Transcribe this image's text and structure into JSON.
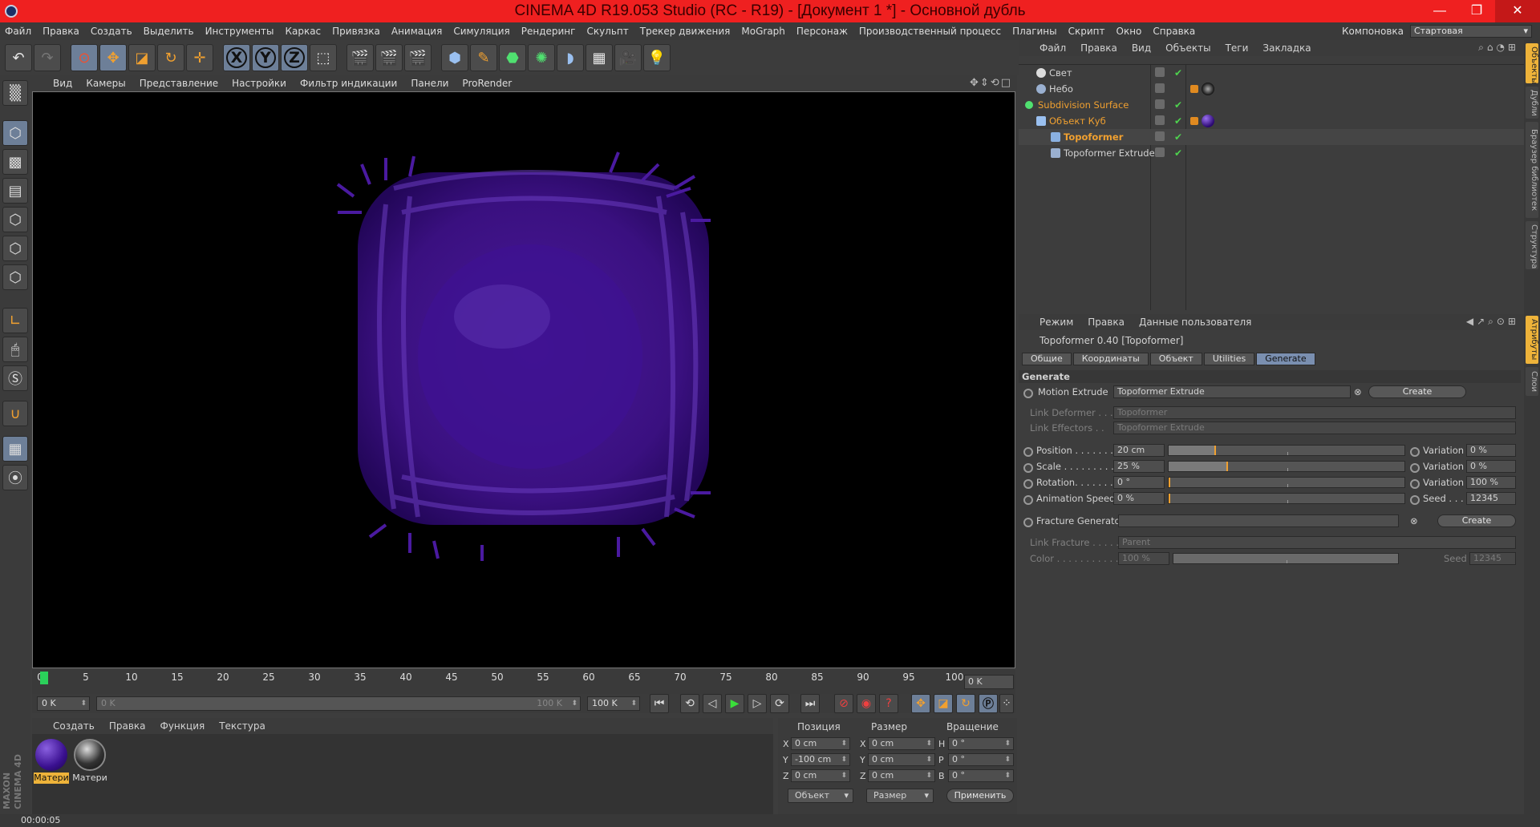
{
  "title": "CINEMA 4D R19.053 Studio (RC - R19) - [Документ 1 *] - Основной дубль",
  "menu": [
    "Файл",
    "Правка",
    "Создать",
    "Выделить",
    "Инструменты",
    "Каркас",
    "Привязка",
    "Анимация",
    "Симуляция",
    "Рендеринг",
    "Скульпт",
    "Трекер движения",
    "MoGraph",
    "Персонаж",
    "Производственный процесс",
    "Плагины",
    "Скрипт",
    "Окно",
    "Справка"
  ],
  "layout": {
    "label": "Компоновка",
    "value": "Стартовая"
  },
  "viewport_menu": [
    "Вид",
    "Камеры",
    "Представление",
    "Настройки",
    "Фильтр индикации",
    "Панели",
    "ProRender"
  ],
  "timeline": {
    "ticks": [
      "0",
      "5",
      "10",
      "15",
      "20",
      "25",
      "30",
      "35",
      "40",
      "45",
      "50",
      "55",
      "60",
      "65",
      "70",
      "75",
      "80",
      "85",
      "90",
      "95",
      "100"
    ],
    "current": "0 K",
    "start": "0 K",
    "range_left": "0 K",
    "range_right": "100 K",
    "end": "100 K"
  },
  "materials": {
    "menu": [
      "Создать",
      "Правка",
      "Функция",
      "Текстура"
    ],
    "items": [
      "Матери",
      "Матери"
    ],
    "maxon": "MAXON CINEMA 4D"
  },
  "coords": {
    "headers": [
      "Позиция",
      "Размер",
      "Вращение"
    ],
    "pos": [
      {
        "axis": "X",
        "value": "0 cm"
      },
      {
        "axis": "Y",
        "value": "-100 cm"
      },
      {
        "axis": "Z",
        "value": "0 cm"
      }
    ],
    "size": [
      {
        "axis": "X",
        "value": "0 cm"
      },
      {
        "axis": "Y",
        "value": "0 cm"
      },
      {
        "axis": "Z",
        "value": "0 cm"
      }
    ],
    "rot": [
      {
        "axis": "H",
        "value": "0 °"
      },
      {
        "axis": "P",
        "value": "0 °"
      },
      {
        "axis": "B",
        "value": "0 °"
      }
    ],
    "mode1": "Объект",
    "mode2": "Размер",
    "apply": "Применить"
  },
  "status": "00:00:05",
  "objects": {
    "menu": [
      "Файл",
      "Правка",
      "Вид",
      "Объекты",
      "Теги",
      "Закладка"
    ],
    "items": [
      "Свет",
      "Небо",
      "Subdivision Surface",
      "Объект Куб",
      "Topoformer",
      "Topoformer Extrude"
    ]
  },
  "vtabs": [
    "Объекты",
    "Дубли",
    "Браузер библиотек",
    "Структура",
    "Атрибуты",
    "Слои"
  ],
  "attributes": {
    "menu": [
      "Режим",
      "Правка",
      "Данные пользователя"
    ],
    "title": "Topoformer 0.40 [Topoformer]",
    "tabs": [
      "Общие",
      "Координаты",
      "Объект",
      "Utilities",
      "Generate"
    ],
    "section": "Generate",
    "motion_extrude": {
      "label": "Motion Extrude",
      "value": "Topoformer Extrude",
      "button": "Create"
    },
    "link_deformer": {
      "label": "Link Deformer . . .",
      "value": "Topoformer"
    },
    "link_effectors": {
      "label": "Link Effectors . .",
      "value": "Topoformer Extrude"
    },
    "params": [
      {
        "label": "Position . . . . . . . .",
        "value": "20 cm",
        "level": 0.2,
        "var_label": "Variation",
        "var_value": "0 %"
      },
      {
        "label": "Scale . . . . . . . . . .",
        "value": "25 %",
        "level": 0.25,
        "var_label": "Variation",
        "var_value": "0 %"
      },
      {
        "label": "Rotation. . . . . . . .",
        "value": "0 °",
        "level": 0,
        "var_label": "Variation",
        "var_value": "100 %"
      },
      {
        "label": "Animation Speed",
        "value": "0 %",
        "level": 0,
        "var_label": "Seed . . . .",
        "var_value": "12345"
      }
    ],
    "fracture": {
      "label": "Fracture Generator",
      "button": "Create"
    },
    "link_fracture": {
      "label": "Link Fracture . . . . .",
      "value": "Parent"
    },
    "color": {
      "label": "Color . . . . . . . . . . .",
      "value": "100 %",
      "seed_label": "Seed",
      "seed_value": "12345"
    }
  }
}
